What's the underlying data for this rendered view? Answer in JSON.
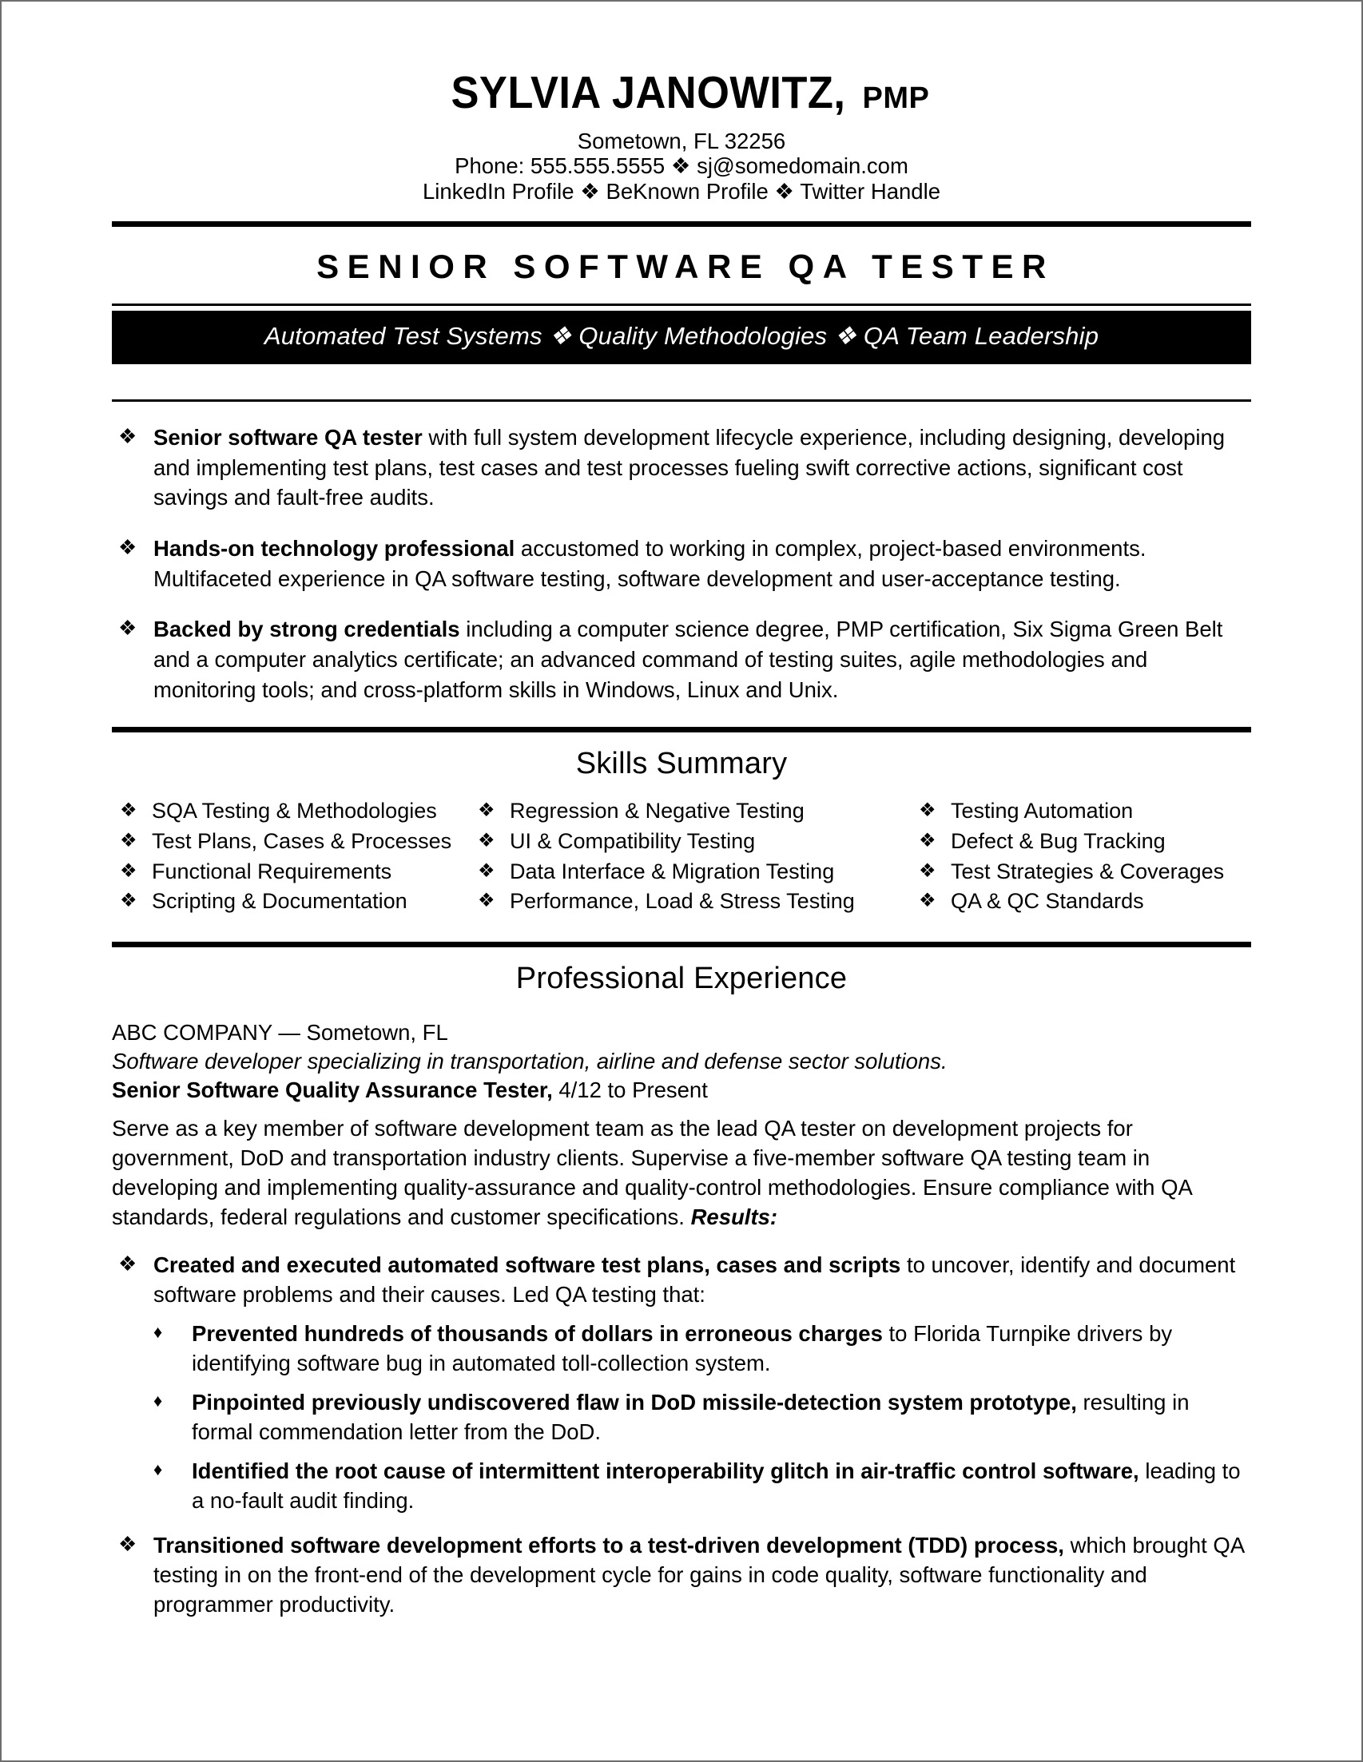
{
  "header": {
    "name": "SYLVIA JANOWITZ,",
    "credential": "PMP",
    "location": "Sometown, FL 32256",
    "contact_line": "Phone: 555.555.5555 ❖ sj@somedomain.com",
    "profiles_line": "LinkedIn Profile ❖ BeKnown Profile ❖ Twitter Handle"
  },
  "job_title": "SENIOR SOFTWARE QA TESTER",
  "banner": "Automated Test Systems ❖ Quality Methodologies ❖ QA Team Leadership",
  "bullet_glyph": "❖",
  "sub_bullet_glyph": "♦",
  "summary": [
    {
      "lead": "Senior software QA tester",
      "rest": " with full system development lifecycle experience, including designing, developing and implementing test plans, test cases and test processes fueling swift corrective actions, significant cost savings and fault-free audits."
    },
    {
      "lead": "Hands-on technology professional",
      "rest": " accustomed to working in complex, project-based environments. Multifaceted experience in QA software testing, software development and user-acceptance testing."
    },
    {
      "lead": "Backed by strong credentials",
      "rest": " including a computer science degree, PMP certification, Six Sigma Green Belt and a computer analytics certificate; an advanced command of testing suites, agile methodologies and monitoring tools; and cross-platform skills in Windows, Linux and Unix."
    }
  ],
  "skills_section": {
    "heading": "Skills Summary",
    "column1": [
      "SQA Testing & Methodologies",
      "Test Plans, Cases & Processes",
      "Functional Requirements",
      "Scripting & Documentation"
    ],
    "column2": [
      "Regression & Negative Testing",
      "UI & Compatibility Testing",
      "Data Interface & Migration Testing",
      "Performance, Load & Stress Testing"
    ],
    "column3": [
      "Testing Automation",
      "Defect & Bug Tracking",
      "Test Strategies & Coverages",
      "QA & QC Standards"
    ]
  },
  "experience_section": {
    "heading": "Professional Experience",
    "company": "ABC COMPANY — Sometown, FL",
    "tagline": "Software developer specializing in transportation, airline and defense sector solutions.",
    "role_title": "Senior Software Quality Assurance Tester,",
    "role_dates": " 4/12 to Present",
    "description": "Serve as a key member of software development team as the lead QA tester on development projects for government, DoD and transportation industry clients. Supervise a five-member software QA testing team in developing and implementing quality-assurance and quality-control methodologies. Ensure compliance with QA standards, federal regulations and customer specifications. ",
    "results_label": "Results:",
    "achievements": [
      {
        "lead": "Created and executed automated software test plans, cases and scripts",
        "rest": " to uncover, identify and document software problems and their causes. Led QA testing that:",
        "sub_items": [
          {
            "lead": "Prevented hundreds of thousands of dollars in erroneous charges",
            "rest": " to Florida Turnpike drivers by identifying software bug in automated toll-collection system."
          },
          {
            "lead": "Pinpointed previously undiscovered flaw in DoD missile-detection system prototype,",
            "rest": " resulting in formal commendation letter from the DoD."
          },
          {
            "lead": "Identified the root cause of intermittent interoperability glitch in air-traffic control software,",
            "rest": " leading to a no-fault audit finding."
          }
        ]
      },
      {
        "lead": "Transitioned software development efforts to a test-driven development (TDD) process,",
        "rest": " which brought QA testing in on the front-end of the development cycle for gains in code quality, software functionality and programmer productivity.",
        "sub_items": []
      }
    ]
  }
}
